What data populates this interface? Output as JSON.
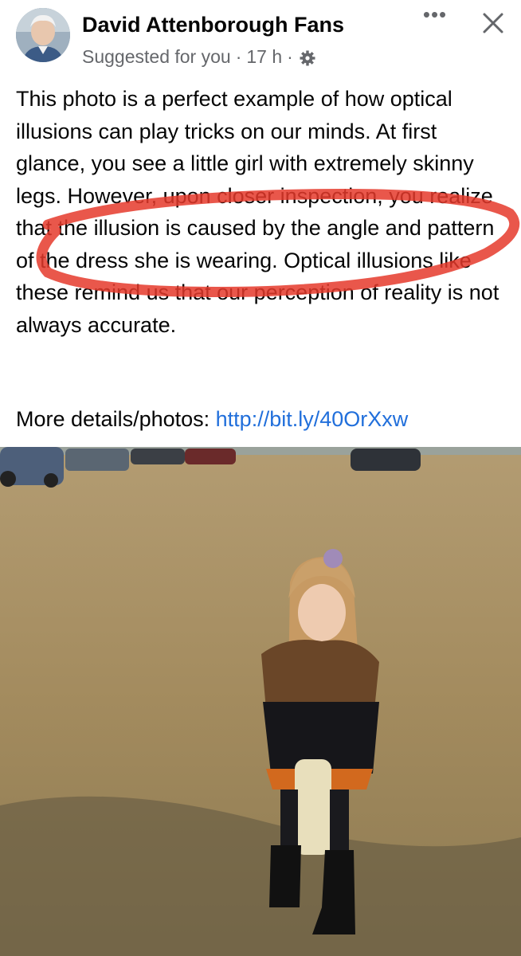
{
  "post": {
    "page_name": "David Attenborough Fans",
    "suggested": "Suggested for you",
    "time": "17 h",
    "dot": "·",
    "audience_icon": "gear-icon",
    "more_label": "•••",
    "close_icon": "close-icon",
    "body": "This photo is a perfect example of how optical illusions can play tricks on our minds. At first glance, you see a little girl with extremely skinny legs. However, upon closer inspection, you realize that the illusion is caused by the angle and pattern of the dress she is wearing. Optical illusions like these remind us that our perception of reality is not always accurate.",
    "details_label": "More details/photos:",
    "details_url": "http://bit.ly/40OrXxw"
  },
  "colors": {
    "link": "#216fdb",
    "secondary_text": "#65676b",
    "annotation_circle": "#e5392c"
  }
}
